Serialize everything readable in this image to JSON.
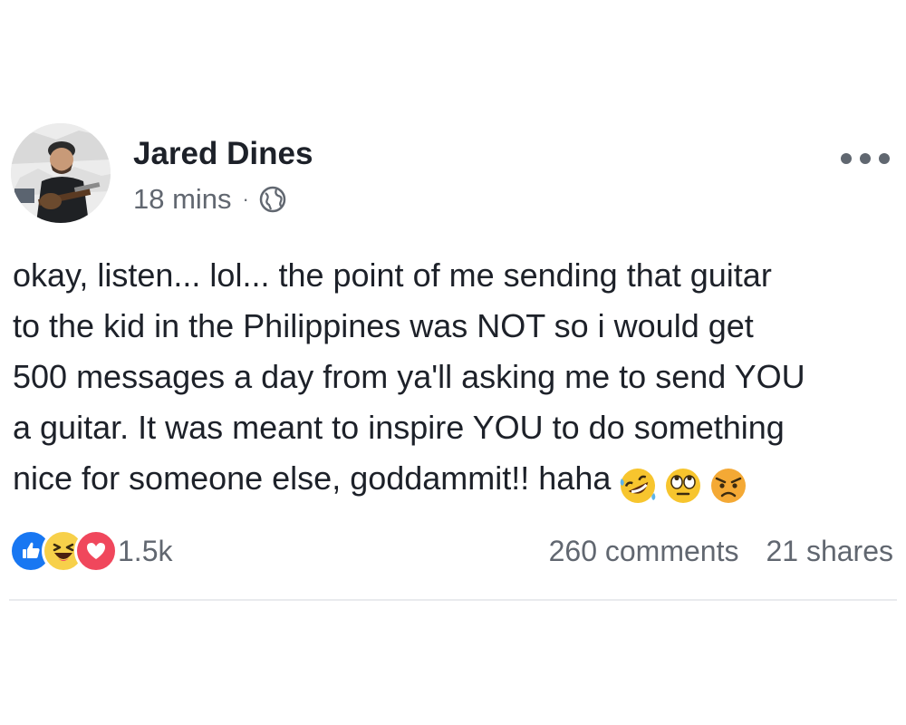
{
  "post": {
    "author": "Jared Dines",
    "time": "18 mins",
    "separator": "·",
    "privacy_icon": "globe-icon",
    "more_icon": "more-options-icon",
    "text": "okay, listen... lol... the point of me sending that guitar\nto the kid in the Philippines was NOT so i would get\n500 messages a day from ya'll asking me to send YOU\na guitar. It was meant to inspire YOU to do something\nnice for someone else, goddammit!! haha",
    "text_emojis": [
      "rolling-on-floor-laughing-emoji",
      "eye-roll-emoji",
      "angry-face-emoji"
    ]
  },
  "reactions": {
    "icons": [
      "like-icon",
      "haha-icon",
      "love-icon"
    ],
    "count": "1.5k"
  },
  "stats": {
    "comments": "260 comments",
    "shares": "21 shares"
  },
  "colors": {
    "like": "#1877f2",
    "haha": "#f7d04a",
    "love": "#f0475c",
    "secondary_text": "#616770",
    "primary_text": "#1d2129",
    "divider": "#e9ebee"
  }
}
